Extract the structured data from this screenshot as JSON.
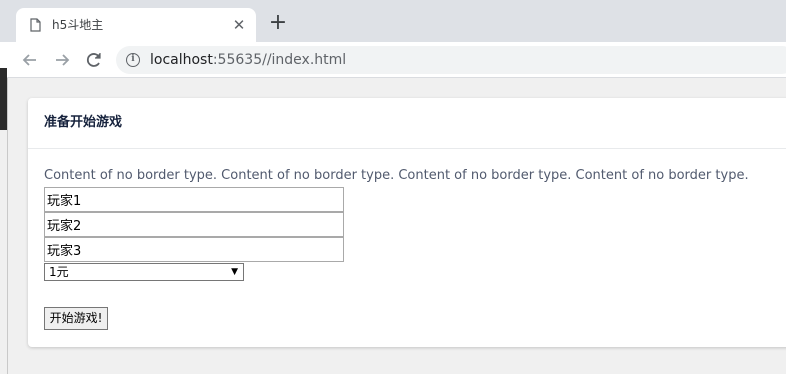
{
  "browser": {
    "tab_title": "h5斗地主",
    "tab_close_glyph": "✕",
    "new_tab_glyph": "+",
    "url_host": "localhost",
    "url_rest": ":55635//index.html",
    "info_glyph": "i"
  },
  "card": {
    "title": "准备开始游戏",
    "description": "Content of no border type. Content of no border type. Content of no border type. Content of no border type."
  },
  "players": [
    {
      "value": "玩家1"
    },
    {
      "value": "玩家2"
    },
    {
      "value": "玩家3"
    }
  ],
  "stake": {
    "selected": "1元",
    "arrow": "▼"
  },
  "start_button": {
    "label": "开始游戏!"
  },
  "colors": {
    "tabstrip": "#dee1e6",
    "page_bg": "#f0f0f0",
    "title_color": "#17233d",
    "text_color": "#515a6e"
  },
  "icons": {
    "tab": "document-icon",
    "back": "back-arrow-icon",
    "forward": "forward-arrow-icon",
    "reload": "reload-icon",
    "info": "info-icon"
  }
}
